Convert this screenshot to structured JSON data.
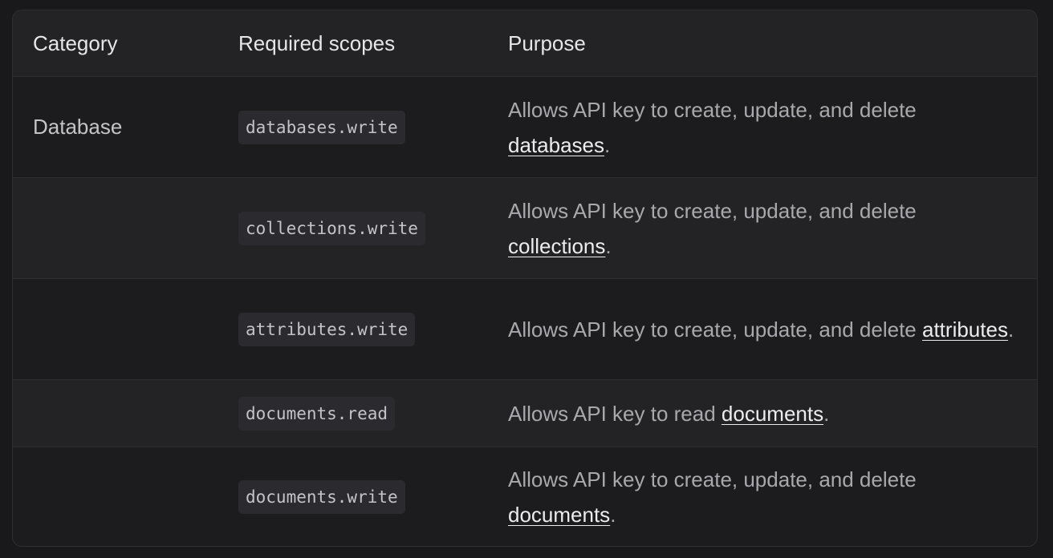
{
  "table": {
    "headers": {
      "category": "Category",
      "scopes": "Required scopes",
      "purpose": "Purpose"
    },
    "rows": [
      {
        "category": "Database",
        "scope": "databases.write",
        "purpose_prefix": "Allows API key to create, update, and delete ",
        "link": "databases",
        "purpose_suffix": "."
      },
      {
        "category": "",
        "scope": "collections.write",
        "purpose_prefix": "Allows API key to create, update, and delete ",
        "link": "collections",
        "purpose_suffix": "."
      },
      {
        "category": "",
        "scope": "attributes.write",
        "purpose_prefix": "Allows API key to create, update, and delete ",
        "link": "attributes",
        "purpose_suffix": "."
      },
      {
        "category": "",
        "scope": "documents.read",
        "purpose_prefix": "Allows API key to read ",
        "link": "documents",
        "purpose_suffix": "."
      },
      {
        "category": "",
        "scope": "documents.write",
        "purpose_prefix": "Allows API key to create, update, and delete ",
        "link": "documents",
        "purpose_suffix": "."
      }
    ]
  }
}
